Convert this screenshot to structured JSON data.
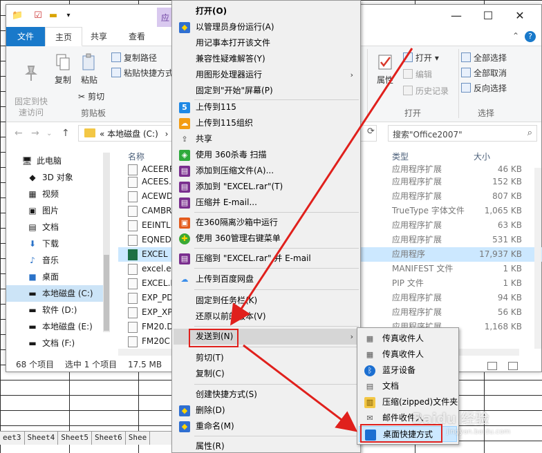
{
  "excel": {
    "sheet_tabs": [
      "eet3",
      "Sheet4",
      "Sheet5",
      "Sheet6",
      "Shee"
    ]
  },
  "explorer": {
    "app_tag": "应",
    "tabs": {
      "file": "文件",
      "home": "主页",
      "share": "共享",
      "view": "查看"
    },
    "ribbon": {
      "pin_quick": "固定到快\n速访问",
      "copy": "复制",
      "paste": "粘贴",
      "copy_path": "复制路径",
      "paste_shortcut": "粘贴快捷方式",
      "cut": "剪切",
      "clipboard_group": "剪贴板",
      "properties": "属性",
      "open": "打开 ▾",
      "edit": "编辑",
      "history": "历史记录",
      "open_group": "打开",
      "select_all": "全部选择",
      "select_none": "全部取消",
      "invert_selection": "反向选择",
      "select_group": "选择"
    },
    "address": {
      "prefix": "«",
      "path": "本地磁盘 (C:)",
      "dropdown": "›"
    },
    "search_placeholder": "搜索\"Office2007\"",
    "nav": [
      {
        "label": "此电脑",
        "icon": "🖥"
      },
      {
        "label": "3D 对象",
        "icon": "◆"
      },
      {
        "label": "视频",
        "icon": "▦"
      },
      {
        "label": "图片",
        "icon": "▣"
      },
      {
        "label": "文档",
        "icon": "▤"
      },
      {
        "label": "下载",
        "icon": "⬇"
      },
      {
        "label": "音乐",
        "icon": "♪"
      },
      {
        "label": "桌面",
        "icon": "■"
      },
      {
        "label": "本地磁盘 (C:)",
        "icon": "▬"
      },
      {
        "label": "软件 (D:)",
        "icon": "▬"
      },
      {
        "label": "本地磁盘 (E:)",
        "icon": "▬"
      },
      {
        "label": "文档 (F:)",
        "icon": "▬"
      }
    ],
    "columns": {
      "name": "名称",
      "type": "类型",
      "size": "大小"
    },
    "files": [
      {
        "name": "ACEERR",
        "type": "应用程序扩展",
        "size": "46 KB"
      },
      {
        "name": "ACEES.",
        "type": "应用程序扩展",
        "size": "152 KB"
      },
      {
        "name": "ACEWD",
        "type": "应用程序扩展",
        "size": "807 KB"
      },
      {
        "name": "CAMBR",
        "type": "TrueType 字体文件",
        "size": "1,065 KB"
      },
      {
        "name": "EEINTL",
        "type": "应用程序扩展",
        "size": "63 KB"
      },
      {
        "name": "EQNED",
        "type": "应用程序扩展",
        "size": "531 KB"
      },
      {
        "name": "EXCEL",
        "type": "应用程序",
        "size": "17,937 KB"
      },
      {
        "name": "excel.ex",
        "type": "MANIFEST 文件",
        "size": "1 KB"
      },
      {
        "name": "EXCEL.P",
        "type": "PIP 文件",
        "size": "1 KB"
      },
      {
        "name": "EXP_PD",
        "type": "应用程序扩展",
        "size": "94 KB"
      },
      {
        "name": "EXP_XP",
        "type": "应用程序扩展",
        "size": "56 KB"
      },
      {
        "name": "FM20.D",
        "type": "应用程序扩展",
        "size": "1,168 KB"
      },
      {
        "name": "FM20C",
        "type": "",
        "size": ""
      }
    ],
    "status": {
      "count": "68 个项目",
      "selected": "选中 1 个项目",
      "size": "17.5 MB"
    }
  },
  "context_menu": {
    "items": [
      {
        "label": "打开(O)"
      },
      {
        "label": "以管理员身份运行(A)"
      },
      {
        "label": "用记事本打开该文件"
      },
      {
        "label": "兼容性疑难解答(Y)"
      },
      {
        "label": "用图形处理器运行"
      },
      {
        "label": "固定到\"开始\"屏幕(P)"
      },
      {
        "label": "上传到115"
      },
      {
        "label": "上传到115组织"
      },
      {
        "label": "共享"
      },
      {
        "label": "使用 360杀毒 扫描"
      },
      {
        "label": "添加到压缩文件(A)..."
      },
      {
        "label": "添加到 \"EXCEL.rar\"(T)"
      },
      {
        "label": "压缩并 E-mail..."
      },
      {
        "label": "在360隔离沙箱中运行"
      },
      {
        "label": "使用 360管理右键菜单"
      },
      {
        "label": "压缩到 \"EXCEL.rar\" 并 E-mail"
      },
      {
        "label": "上传到百度网盘"
      },
      {
        "label": "固定到任务栏(K)"
      },
      {
        "label": "还原以前的版本(V)"
      },
      {
        "label": "发送到(N)"
      },
      {
        "label": "剪切(T)"
      },
      {
        "label": "复制(C)"
      },
      {
        "label": "创建快捷方式(S)"
      },
      {
        "label": "删除(D)"
      },
      {
        "label": "重命名(M)"
      },
      {
        "label": "属性(R)"
      }
    ]
  },
  "send_to_menu": {
    "items": [
      {
        "label": "传真收件人"
      },
      {
        "label": "传真收件人"
      },
      {
        "label": "蓝牙设备"
      },
      {
        "label": "文档"
      },
      {
        "label": "压缩(zipped)文件夹"
      },
      {
        "label": "邮件收件人"
      },
      {
        "label": "桌面快捷方式"
      }
    ]
  },
  "watermark": {
    "text": "Baidu 经验",
    "url": "jingyan.baidu.com"
  },
  "colors": {
    "accent": "#1979ca",
    "highlight_red": "#e0201c",
    "selection": "#cce8ff"
  }
}
